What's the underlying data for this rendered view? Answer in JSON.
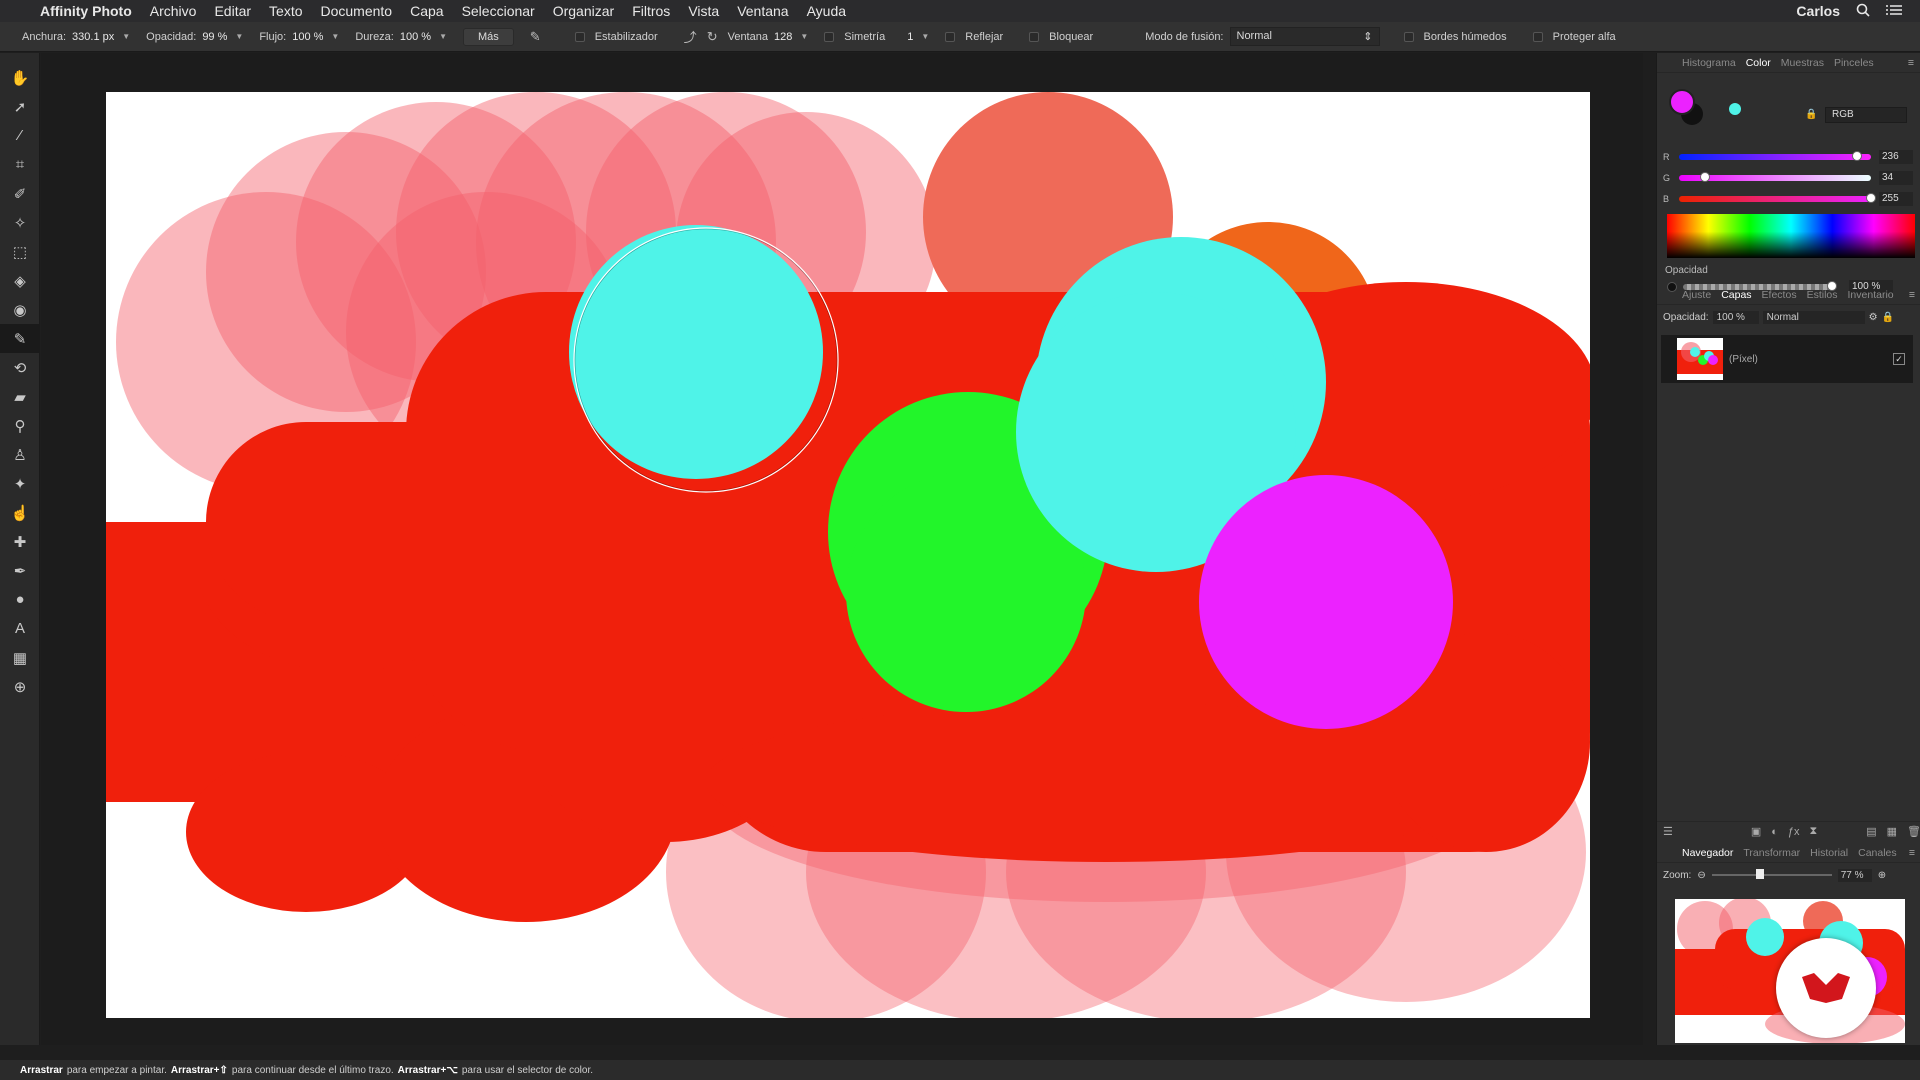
{
  "menubar": {
    "app_name": "Affinity Photo",
    "items": [
      "Archivo",
      "Editar",
      "Texto",
      "Documento",
      "Capa",
      "Seleccionar",
      "Organizar",
      "Filtros",
      "Vista",
      "Ventana",
      "Ayuda"
    ],
    "user": "Carlos"
  },
  "context_toolbar": {
    "width_label": "Anchura:",
    "width_value": "330.1 px",
    "opacity_label": "Opacidad:",
    "opacity_value": "99 %",
    "flow_label": "Flujo:",
    "flow_value": "100 %",
    "hardness_label": "Dureza:",
    "hardness_value": "100 %",
    "more_button": "Más",
    "stabilizer_label": "Estabilizador",
    "window_label": "Ventana",
    "window_value": "128",
    "symmetry_label": "Simetría",
    "symmetry_value": "1",
    "mirror_label": "Reflejar",
    "lock_label": "Bloquear",
    "blend_mode_label": "Modo de fusión:",
    "blend_mode_value": "Normal",
    "wet_edges_label": "Bordes húmedos",
    "protect_alpha_label": "Proteger alfa"
  },
  "color_panel": {
    "tabs": [
      "Histograma",
      "Color",
      "Muestras",
      "Pinceles"
    ],
    "active_tab": "Color",
    "model": "RGB",
    "r_label": "R",
    "r_value": "236",
    "r_fraction": 0.925,
    "g_label": "G",
    "g_value": "34",
    "g_fraction": 0.133,
    "b_label": "B",
    "b_value": "255",
    "b_fraction": 1.0,
    "opacity_label": "Opacidad",
    "opacity_value": "100 %",
    "primary_color": "#ec22ff",
    "secondary_color": "#4ff3e8"
  },
  "layers_panel": {
    "tabs": [
      "Ajuste",
      "Capas",
      "Efectos",
      "Estilos",
      "Inventario"
    ],
    "active_tab": "Capas",
    "opacity_label": "Opacidad:",
    "opacity_value": "100 %",
    "blend_value": "Normal",
    "layer_name": "(Píxel)",
    "layer_visible": "✓"
  },
  "navigator_panel": {
    "tabs": [
      "Navegador",
      "Transformar",
      "Historial",
      "Canales"
    ],
    "active_tab": "Navegador",
    "zoom_label": "Zoom:",
    "zoom_value": "77 %"
  },
  "status_bar": {
    "part1_bold": "Arrastrar",
    "part1": "para empezar a pintar.",
    "part2_bold": "Arrastrar+⇧",
    "part2": "para continuar desde el último trazo.",
    "part3_bold": "Arrastrar+⌥",
    "part3": "para usar el selector de color."
  },
  "colors": {
    "paint_red": "#f0200c",
    "paint_pink": "#f7858a",
    "cyan": "#4ff3e8",
    "green": "#22f52a",
    "magenta": "#ec22ff",
    "orange": "#f0661a",
    "salmon": "#ef6a58"
  },
  "tools": [
    "hand-icon",
    "move-icon",
    "color-picker-icon",
    "crop-icon",
    "paint-brush-icon",
    "flood-select-icon",
    "marquee-icon",
    "fill-icon",
    "gradient-icon",
    "brush-icon",
    "color-replace-icon",
    "eraser-icon",
    "dodge-icon",
    "clone-icon",
    "blemish-icon",
    "smudge-icon",
    "healing-icon",
    "pen-icon",
    "shape-icon",
    "text-icon",
    "mesh-icon",
    "zoom-icon"
  ]
}
